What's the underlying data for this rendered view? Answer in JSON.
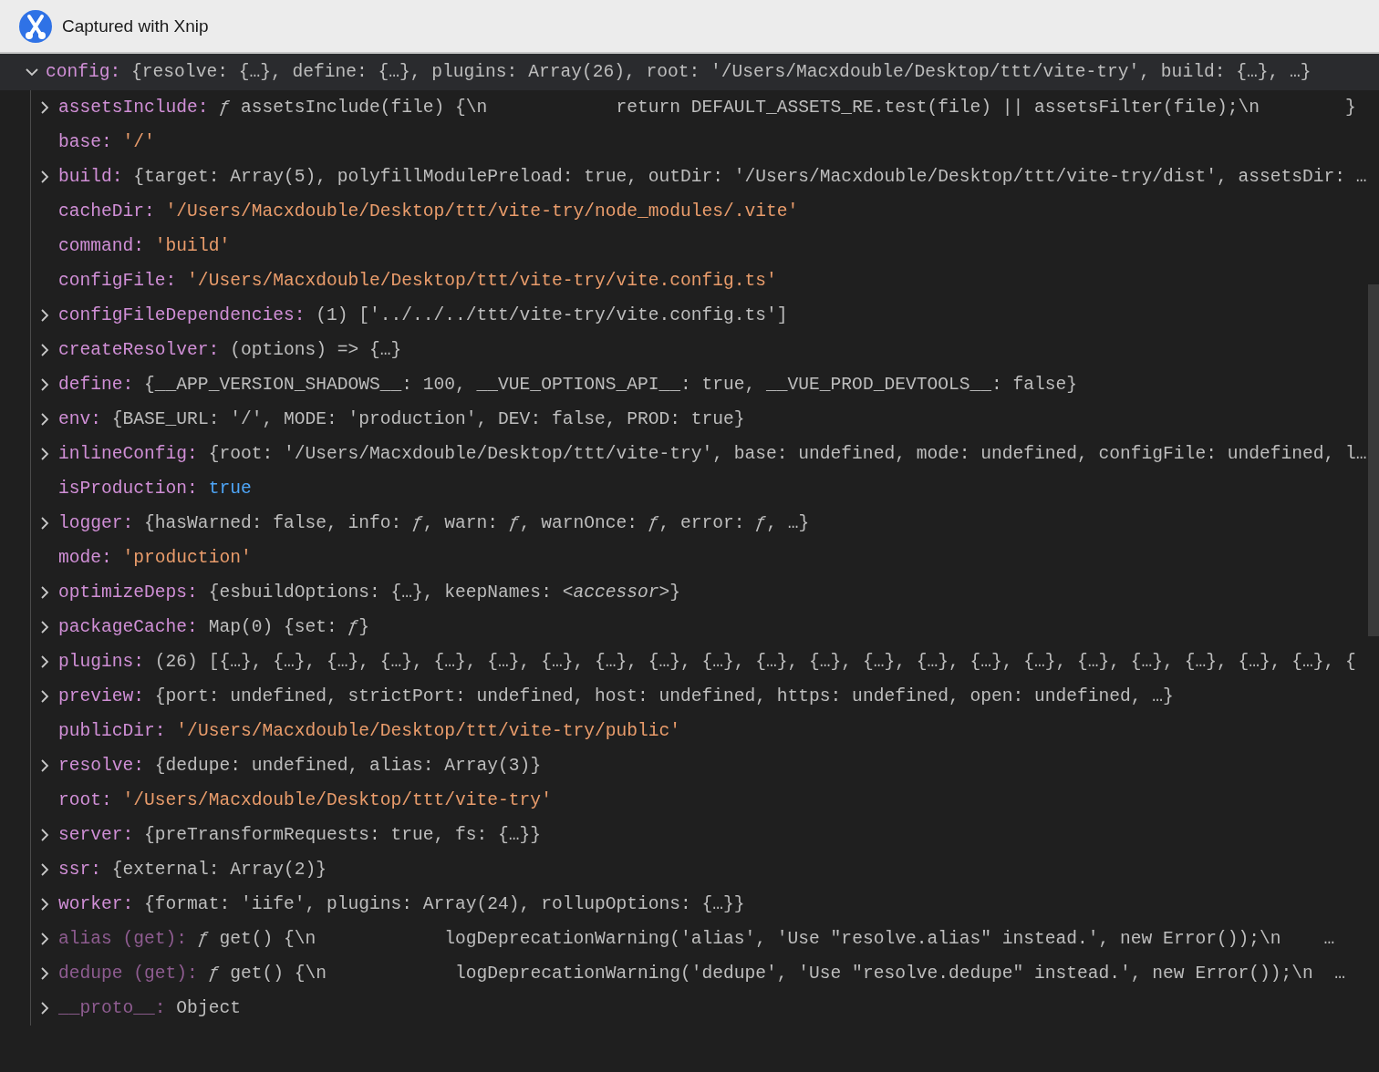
{
  "title_bar": {
    "title": "Captured with Xnip"
  },
  "console": {
    "root": {
      "key": "config:",
      "value": "{resolve: {…}, define: {…}, plugins: Array(26), root: '/Users/Macxdouble/Desktop/ttt/vite-try', build: {…}, …}",
      "expanded": true,
      "children": [
        {
          "key": "assetsInclude:",
          "value": "*ƒ* assetsInclude(file) {\\n            return DEFAULT_ASSETS_RE.test(file) || assetsFilter(file);\\n        }",
          "kind": "preview",
          "expandable": true,
          "accessor": false
        },
        {
          "key": "base:",
          "value": "'/'",
          "kind": "string",
          "expandable": false,
          "accessor": false
        },
        {
          "key": "build:",
          "value": "{target: Array(5), polyfillModulePreload: true, outDir: '/Users/Macxdouble/Desktop/ttt/vite-try/dist', assetsDir: …",
          "kind": "preview",
          "expandable": true,
          "accessor": false
        },
        {
          "key": "cacheDir:",
          "value": "'/Users/Macxdouble/Desktop/ttt/vite-try/node_modules/.vite'",
          "kind": "string",
          "expandable": false,
          "accessor": false
        },
        {
          "key": "command:",
          "value": "'build'",
          "kind": "string",
          "expandable": false,
          "accessor": false
        },
        {
          "key": "configFile:",
          "value": "'/Users/Macxdouble/Desktop/ttt/vite-try/vite.config.ts'",
          "kind": "string",
          "expandable": false,
          "accessor": false
        },
        {
          "key": "configFileDependencies:",
          "value": "(1) ['../../../ttt/vite-try/vite.config.ts']",
          "kind": "preview",
          "expandable": true,
          "accessor": false
        },
        {
          "key": "createResolver:",
          "value": "(options) => {…}",
          "kind": "preview",
          "expandable": true,
          "accessor": false
        },
        {
          "key": "define:",
          "value": "{__APP_VERSION_SHADOWS__: 100, __VUE_OPTIONS_API__: true, __VUE_PROD_DEVTOOLS__: false}",
          "kind": "preview",
          "expandable": true,
          "accessor": false
        },
        {
          "key": "env:",
          "value": "{BASE_URL: '/', MODE: 'production', DEV: false, PROD: true}",
          "kind": "preview",
          "expandable": true,
          "accessor": false
        },
        {
          "key": "inlineConfig:",
          "value": "{root: '/Users/Macxdouble/Desktop/ttt/vite-try', base: undefined, mode: undefined, configFile: undefined, l…",
          "kind": "preview",
          "expandable": true,
          "accessor": false
        },
        {
          "key": "isProduction:",
          "value": "true",
          "kind": "boolean",
          "expandable": false,
          "accessor": false
        },
        {
          "key": "logger:",
          "value": "{hasWarned: false, info: *ƒ*, warn: *ƒ*, warnOnce: *ƒ*, error: *ƒ*, …}",
          "kind": "preview",
          "expandable": true,
          "accessor": false
        },
        {
          "key": "mode:",
          "value": "'production'",
          "kind": "string",
          "expandable": false,
          "accessor": false
        },
        {
          "key": "optimizeDeps:",
          "value": "{esbuildOptions: {…}, keepNames: *<accessor>*}",
          "kind": "preview",
          "expandable": true,
          "accessor": false
        },
        {
          "key": "packageCache:",
          "value": "Map(0) {set: *ƒ*}",
          "kind": "preview",
          "expandable": true,
          "accessor": false
        },
        {
          "key": "plugins:",
          "value": "(26) [{…}, {…}, {…}, {…}, {…}, {…}, {…}, {…}, {…}, {…}, {…}, {…}, {…}, {…}, {…}, {…}, {…}, {…}, {…}, {…}, {…}, {",
          "kind": "preview",
          "expandable": true,
          "accessor": false
        },
        {
          "key": "preview:",
          "value": "{port: undefined, strictPort: undefined, host: undefined, https: undefined, open: undefined, …}",
          "kind": "preview",
          "expandable": true,
          "accessor": false
        },
        {
          "key": "publicDir:",
          "value": "'/Users/Macxdouble/Desktop/ttt/vite-try/public'",
          "kind": "string",
          "expandable": false,
          "accessor": false
        },
        {
          "key": "resolve:",
          "value": "{dedupe: undefined, alias: Array(3)}",
          "kind": "preview",
          "expandable": true,
          "accessor": false
        },
        {
          "key": "root:",
          "value": "'/Users/Macxdouble/Desktop/ttt/vite-try'",
          "kind": "string",
          "expandable": false,
          "accessor": false
        },
        {
          "key": "server:",
          "value": "{preTransformRequests: true, fs: {…}}",
          "kind": "preview",
          "expandable": true,
          "accessor": false
        },
        {
          "key": "ssr:",
          "value": "{external: Array(2)}",
          "kind": "preview",
          "expandable": true,
          "accessor": false
        },
        {
          "key": "worker:",
          "value": "{format: 'iife', plugins: Array(24), rollupOptions: {…}}",
          "kind": "preview",
          "expandable": true,
          "accessor": false
        },
        {
          "key": "alias (get):",
          "value": "*ƒ* get() {\\n            logDeprecationWarning('alias', 'Use \"resolve.alias\" instead.', new Error());\\n    …",
          "kind": "preview",
          "expandable": true,
          "accessor": true
        },
        {
          "key": "dedupe (get):",
          "value": "*ƒ* get() {\\n            logDeprecationWarning('dedupe', 'Use \"resolve.dedupe\" instead.', new Error());\\n  …",
          "kind": "preview",
          "expandable": true,
          "accessor": true
        },
        {
          "key": "__proto__:",
          "value": "Object",
          "kind": "preview",
          "expandable": true,
          "accessor": true
        }
      ]
    }
  }
}
